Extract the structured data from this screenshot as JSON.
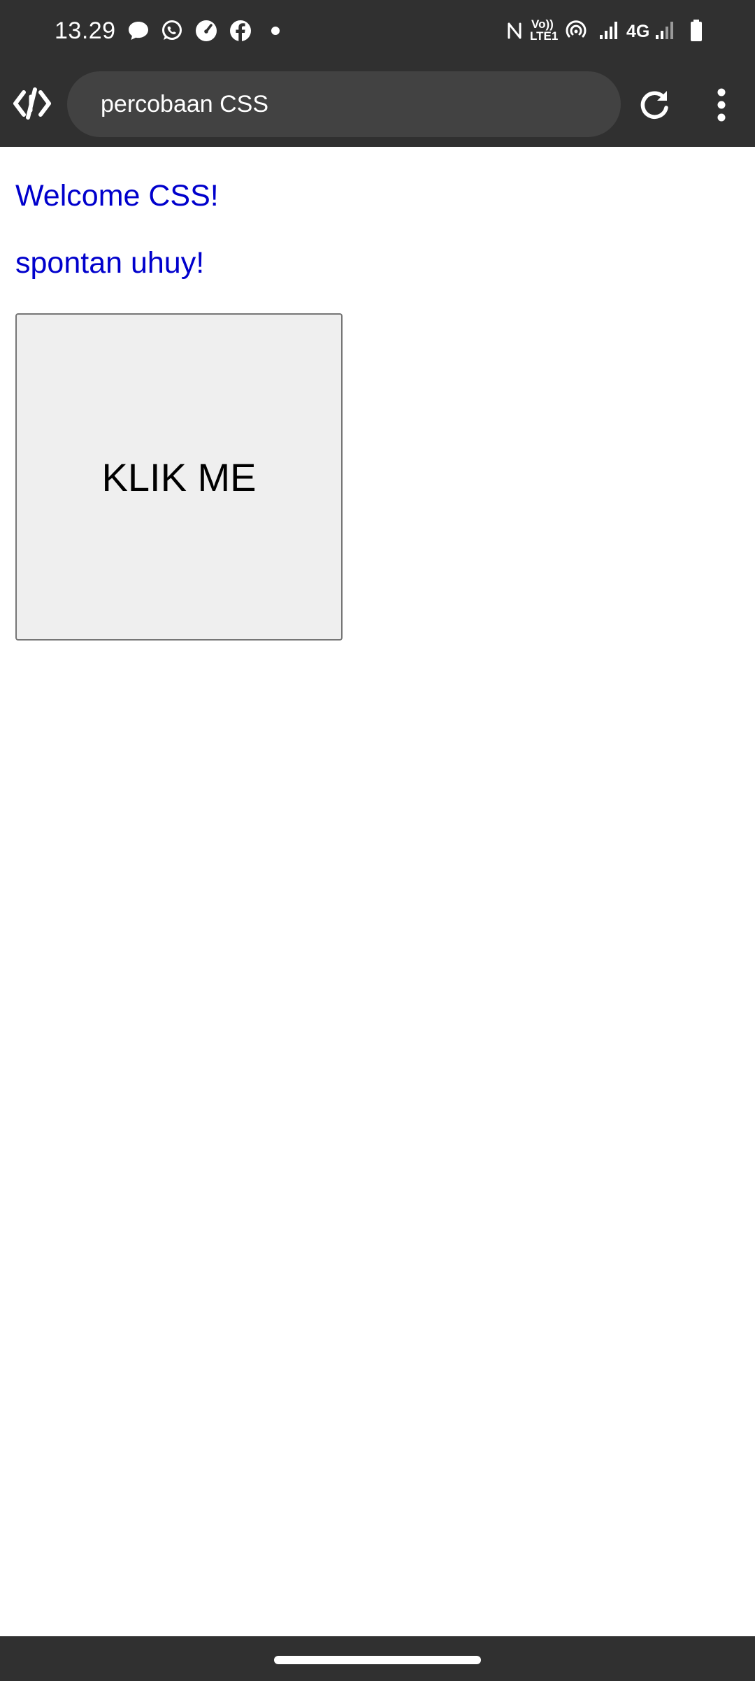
{
  "status_bar": {
    "time": "13.29",
    "network_label": "4G",
    "volte_label_top": "Vo))",
    "volte_label_bottom": "LTE1",
    "notification_icons": [
      "message-icon",
      "whatsapp-icon",
      "speedometer-icon",
      "facebook-icon",
      "dot-icon"
    ],
    "system_icons": [
      "nfc-icon",
      "volte-icon",
      "hotspot-icon",
      "signal-icon",
      "signal-icon-2",
      "battery-icon"
    ]
  },
  "browser": {
    "title": "percobaan CSS",
    "logo_icon": "code-logo-icon",
    "reload_icon": "reload-icon",
    "menu_icon": "more-vertical-icon"
  },
  "page": {
    "heading_1": "Welcome CSS!",
    "heading_2": "spontan uhuy!",
    "button_label": "KLIK ME"
  },
  "colors": {
    "bar_background": "#303030",
    "url_background": "#424242",
    "text_blue": "#0000cc",
    "button_background": "#efefef"
  }
}
